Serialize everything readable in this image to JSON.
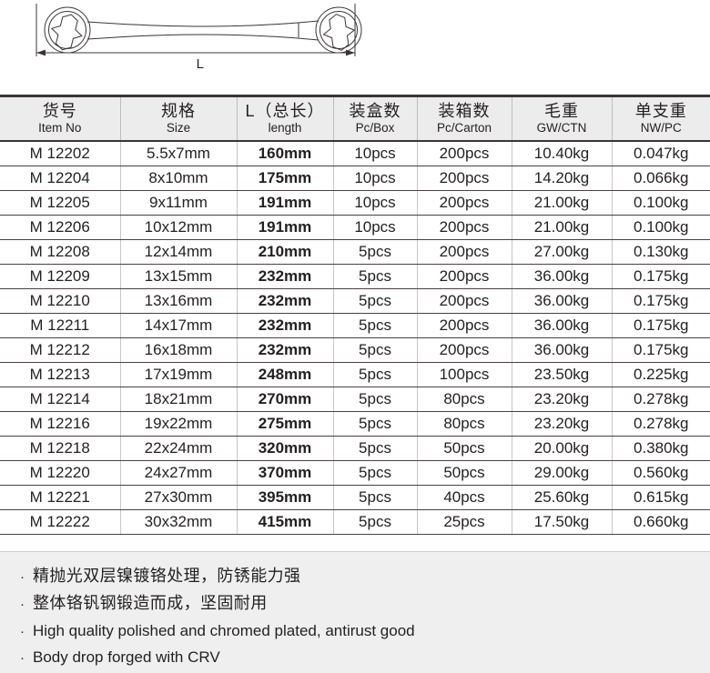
{
  "product_figure": {
    "dimension_label": "L",
    "icon": "double-ring-spanner-drawing"
  },
  "table": {
    "columns": [
      {
        "cn": "货号",
        "en": "Item No",
        "key": "item_no"
      },
      {
        "cn": "规格",
        "en": "Size",
        "key": "size"
      },
      {
        "cn": "L（总长）",
        "en": "length",
        "key": "length"
      },
      {
        "cn": "装盒数",
        "en": "Pc/Box",
        "key": "pc_box"
      },
      {
        "cn": "装箱数",
        "en": "Pc/Carton",
        "key": "pc_carton"
      },
      {
        "cn": "毛重",
        "en": "GW/CTN",
        "key": "gw_ctn"
      },
      {
        "cn": "单支重",
        "en": "NW/PC",
        "key": "nw_pc"
      }
    ],
    "rows": [
      {
        "item_no": "M 12202",
        "size": "5.5x7mm",
        "length": "160mm",
        "pc_box": "10pcs",
        "pc_carton": "200pcs",
        "gw_ctn": "10.40kg",
        "nw_pc": "0.047kg"
      },
      {
        "item_no": "M 12204",
        "size": "8x10mm",
        "length": "175mm",
        "pc_box": "10pcs",
        "pc_carton": "200pcs",
        "gw_ctn": "14.20kg",
        "nw_pc": "0.066kg"
      },
      {
        "item_no": "M 12205",
        "size": "9x11mm",
        "length": "191mm",
        "pc_box": "10pcs",
        "pc_carton": "200pcs",
        "gw_ctn": "21.00kg",
        "nw_pc": "0.100kg"
      },
      {
        "item_no": "M 12206",
        "size": "10x12mm",
        "length": "191mm",
        "pc_box": "10pcs",
        "pc_carton": "200pcs",
        "gw_ctn": "21.00kg",
        "nw_pc": "0.100kg"
      },
      {
        "item_no": "M 12208",
        "size": "12x14mm",
        "length": "210mm",
        "pc_box": "5pcs",
        "pc_carton": "200pcs",
        "gw_ctn": "27.00kg",
        "nw_pc": "0.130kg"
      },
      {
        "item_no": "M 12209",
        "size": "13x15mm",
        "length": "232mm",
        "pc_box": "5pcs",
        "pc_carton": "200pcs",
        "gw_ctn": "36.00kg",
        "nw_pc": "0.175kg"
      },
      {
        "item_no": "M 12210",
        "size": "13x16mm",
        "length": "232mm",
        "pc_box": "5pcs",
        "pc_carton": "200pcs",
        "gw_ctn": "36.00kg",
        "nw_pc": "0.175kg"
      },
      {
        "item_no": "M 12211",
        "size": "14x17mm",
        "length": "232mm",
        "pc_box": "5pcs",
        "pc_carton": "200pcs",
        "gw_ctn": "36.00kg",
        "nw_pc": "0.175kg"
      },
      {
        "item_no": "M 12212",
        "size": "16x18mm",
        "length": "232mm",
        "pc_box": "5pcs",
        "pc_carton": "200pcs",
        "gw_ctn": "36.00kg",
        "nw_pc": "0.175kg"
      },
      {
        "item_no": "M 12213",
        "size": "17x19mm",
        "length": "248mm",
        "pc_box": "5pcs",
        "pc_carton": "100pcs",
        "gw_ctn": "23.50kg",
        "nw_pc": "0.225kg"
      },
      {
        "item_no": "M 12214",
        "size": "18x21mm",
        "length": "270mm",
        "pc_box": "5pcs",
        "pc_carton": "80pcs",
        "gw_ctn": "23.20kg",
        "nw_pc": "0.278kg"
      },
      {
        "item_no": "M 12216",
        "size": "19x22mm",
        "length": "275mm",
        "pc_box": "5pcs",
        "pc_carton": "80pcs",
        "gw_ctn": "23.20kg",
        "nw_pc": "0.278kg"
      },
      {
        "item_no": "M 12218",
        "size": "22x24mm",
        "length": "320mm",
        "pc_box": "5pcs",
        "pc_carton": "50pcs",
        "gw_ctn": "20.00kg",
        "nw_pc": "0.380kg"
      },
      {
        "item_no": "M 12220",
        "size": "24x27mm",
        "length": "370mm",
        "pc_box": "5pcs",
        "pc_carton": "50pcs",
        "gw_ctn": "29.00kg",
        "nw_pc": "0.560kg"
      },
      {
        "item_no": "M 12221",
        "size": "27x30mm",
        "length": "395mm",
        "pc_box": "5pcs",
        "pc_carton": "40pcs",
        "gw_ctn": "25.60kg",
        "nw_pc": "0.615kg"
      },
      {
        "item_no": "M 12222",
        "size": "30x32mm",
        "length": "415mm",
        "pc_box": "5pcs",
        "pc_carton": "25pcs",
        "gw_ctn": "17.50kg",
        "nw_pc": "0.660kg"
      }
    ]
  },
  "features": {
    "bullet": "·",
    "items": [
      {
        "text": "精抛光双层镍镀铬处理，防锈能力强",
        "lang": "cn"
      },
      {
        "text": "整体铬钒钢锻造而成，坚固耐用",
        "lang": "cn"
      },
      {
        "text": "High quality polished and chromed plated, antirust good",
        "lang": "en"
      },
      {
        "text": "Body drop forged with CRV",
        "lang": "en"
      }
    ]
  },
  "colors": {
    "ink": "#231f20",
    "rule": "#4a4140",
    "header_bg": "#ececec",
    "panel_bg": "#efefef"
  }
}
